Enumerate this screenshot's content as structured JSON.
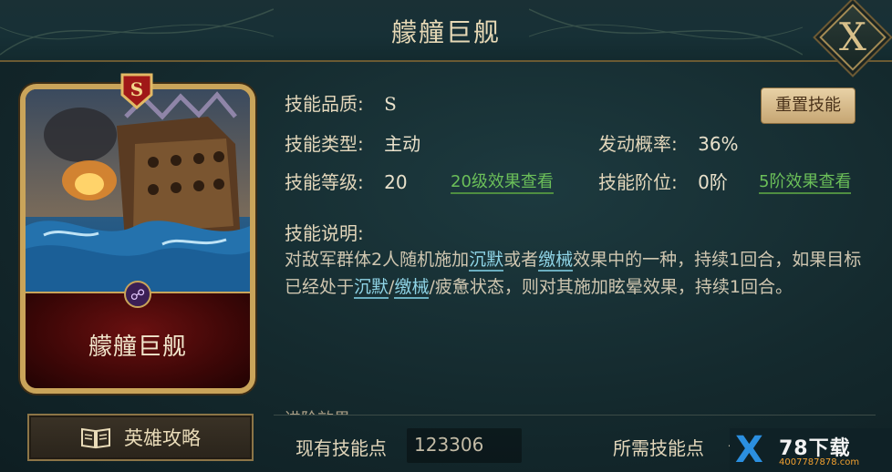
{
  "header": {
    "title": "艨艟巨舰",
    "close_label": "X"
  },
  "card": {
    "rank": "S",
    "name": "艨艟巨舰"
  },
  "skill": {
    "quality_label": "技能品质:",
    "quality_value": "S",
    "type_label": "技能类型:",
    "type_value": "主动",
    "chance_label": "发动概率:",
    "chance_value": "36%",
    "level_label": "技能等级:",
    "level_value": "20",
    "level_link": "20级效果查看",
    "tier_label": "技能阶位:",
    "tier_value": "0阶",
    "tier_link": "5阶效果查看",
    "reset_button": "重置技能"
  },
  "description": {
    "title": "技能说明:",
    "p1": "对敌军群体2人随机施加",
    "kw1": "沉默",
    "p2": "或者",
    "kw2": "缴械",
    "p3": "效果中的一种，持续1回合，如果目标已经处于",
    "kw3": "沉默",
    "p4": "/",
    "kw4": "缴械",
    "p5": "/疲惫状态，则对其施加眩晕效果，持续1回合。"
  },
  "advanced_label": "进阶效果",
  "guide_button": "英雄攻略",
  "points": {
    "current_label": "现有技能点",
    "current_value": "123306",
    "required_label": "所需技能点",
    "required_value": "—"
  },
  "watermark": {
    "logo": "X",
    "name": "78下载",
    "url": "4007787878.com"
  },
  "colors": {
    "gold": "#c9a45a",
    "link_green": "#6bbf59",
    "keyword_cyan": "#8fd4e6"
  },
  "icons": [
    "close-icon",
    "rank-s-icon",
    "faction-icon",
    "book-icon",
    "site-logo-icon"
  ]
}
